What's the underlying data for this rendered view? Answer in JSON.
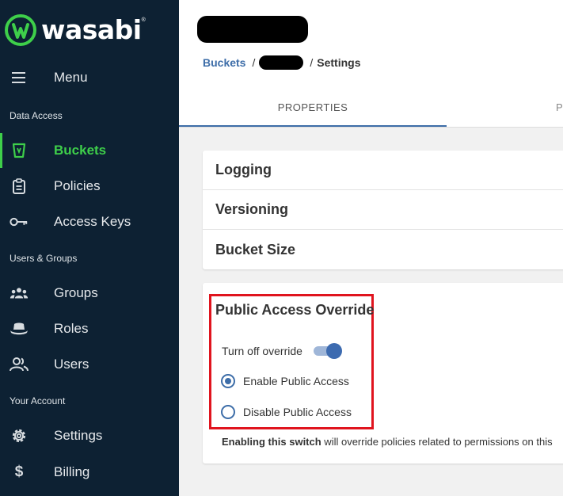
{
  "brand": {
    "name": "wasabi",
    "tm": "®",
    "accent": "#3ecf4a",
    "sidebar_bg": "#0d2133"
  },
  "sidebar": {
    "menu_label": "Menu",
    "sections": {
      "data_access": "Data Access",
      "users_groups": "Users & Groups",
      "your_account": "Your Account"
    },
    "items": [
      {
        "label": "Buckets",
        "icon": "bucket-icon",
        "active": true
      },
      {
        "label": "Policies",
        "icon": "clipboard-icon"
      },
      {
        "label": "Access Keys",
        "icon": "key-icon"
      },
      {
        "label": "Groups",
        "icon": "groups-icon"
      },
      {
        "label": "Roles",
        "icon": "hat-icon"
      },
      {
        "label": "Users",
        "icon": "users-icon"
      },
      {
        "label": "Settings",
        "icon": "gear-icon"
      },
      {
        "label": "Billing",
        "icon": "dollar-icon"
      }
    ]
  },
  "breadcrumb": {
    "root": "Buckets",
    "sep": "/",
    "current": "Settings"
  },
  "tabs": [
    {
      "label": "PROPERTIES",
      "active": true
    },
    {
      "label": "P"
    }
  ],
  "accordion": [
    {
      "label": "Logging"
    },
    {
      "label": "Versioning"
    },
    {
      "label": "Bucket Size"
    }
  ],
  "public_access": {
    "title": "Public Access Override",
    "toggle_label": "Turn off override",
    "toggle_on": true,
    "options": [
      {
        "label": "Enable Public Access",
        "checked": true
      },
      {
        "label": "Disable Public Access",
        "checked": false
      }
    ],
    "note_bold": "Enabling this switch",
    "note_rest": " will override policies related to permissions on this"
  },
  "colors": {
    "link": "#3d6da8",
    "highlight": "#e0141e"
  }
}
